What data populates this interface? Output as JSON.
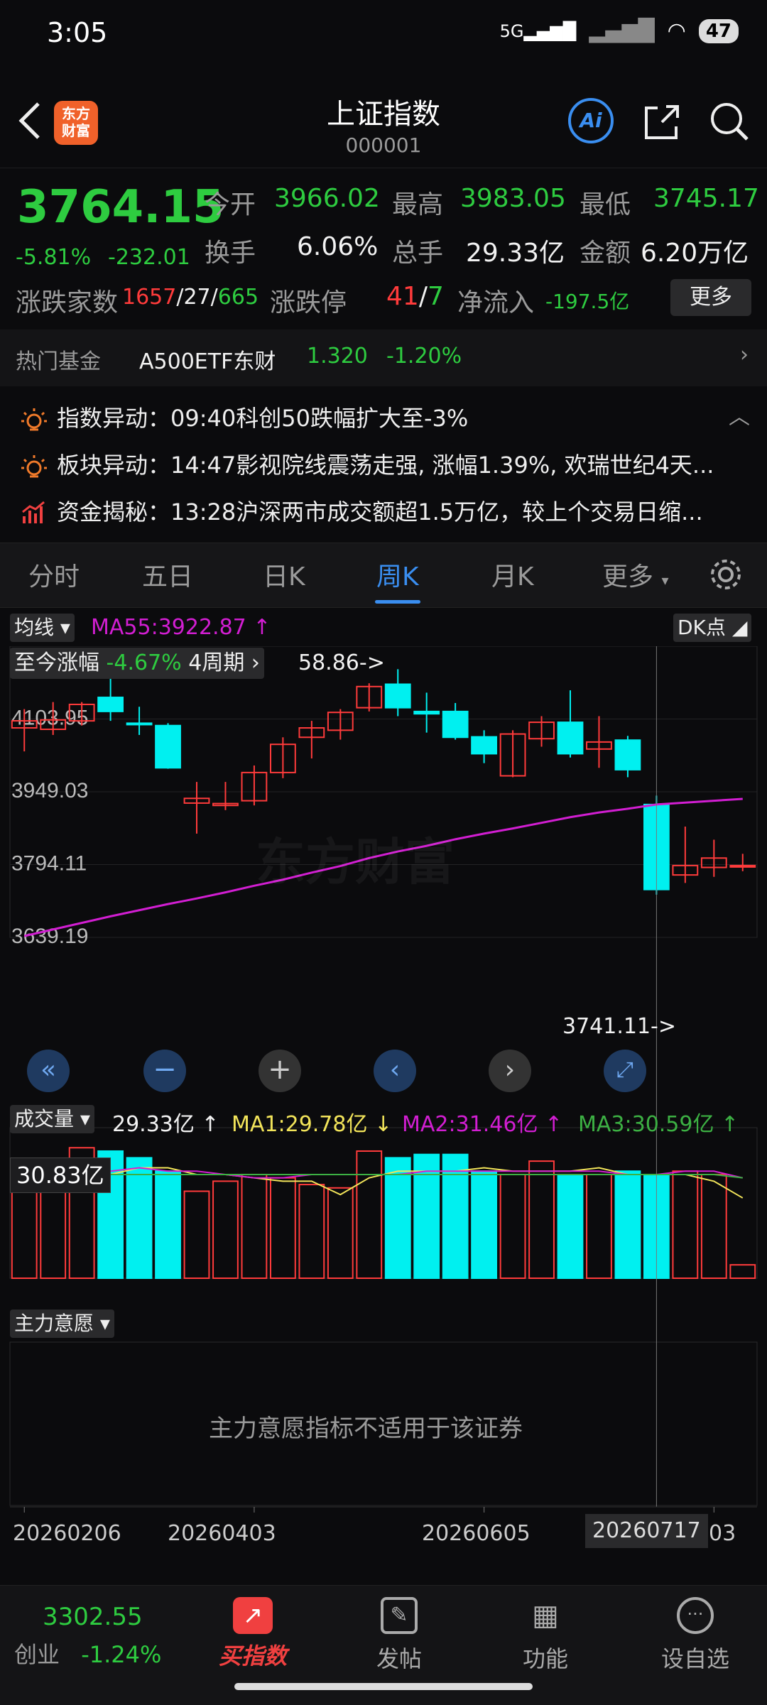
{
  "status": {
    "time": "3:05",
    "network": "5G",
    "battery": "47"
  },
  "header": {
    "title": "上证指数",
    "code": "000001",
    "logo_text": "东方财富",
    "ai_label": "Ai"
  },
  "quote": {
    "price": "3764.15",
    "change_pct": "-5.81%",
    "change_abs": "-232.01",
    "open_label": "今开",
    "open": "3966.02",
    "high_label": "最高",
    "high": "3983.05",
    "low_label": "最低",
    "low": "3745.17",
    "turnover_label": "换手",
    "turnover": "6.06%",
    "volume_label": "总手",
    "volume": "29.33亿",
    "amount_label": "金额",
    "amount": "6.20万亿",
    "breadth_label": "涨跌家数",
    "up": "1657",
    "flat": "27",
    "down": "665",
    "limit_label": "涨跌停",
    "limit_up": "41",
    "limit_down": "7",
    "netflow_label": "净流入",
    "netflow": "-197.5亿",
    "more_label": "更多"
  },
  "hot_fund": {
    "label": "热门基金",
    "name": "A500ETF东财",
    "price": "1.320",
    "change": "-1.20%"
  },
  "news": [
    {
      "text": "指数异动：09:40科创50跌幅扩大至-3%",
      "icon": "bulb-icon"
    },
    {
      "text": "板块异动：14:47影视院线震荡走强, 涨幅1.39%, 欢瑞世纪4天...",
      "icon": "bulb-icon"
    },
    {
      "text": "资金揭秘：13:28沪深两市成交额超1.5万亿，较上个交易日缩...",
      "icon": "money-chart-icon"
    }
  ],
  "tabs": [
    "分时",
    "五日",
    "日K",
    "周K",
    "月K",
    "更多"
  ],
  "chart": {
    "ma_selector": "均线",
    "ma55_label": "MA55:3922.87 ↑",
    "dk_label": "DK点",
    "since_label": "至今涨幅",
    "since_value": "-4.67%",
    "since_period": "4周期",
    "high_marker": "58.86->",
    "low_marker": "3741.11->",
    "watermark": "东方财富",
    "volume_selector": "成交量",
    "volume_value": "29.33亿 ↑",
    "ma1": "MA1:29.78亿 ↓",
    "ma2": "MA2:31.46亿 ↑",
    "ma3": "MA3:30.59亿 ↑",
    "cursor_volume": "30.83亿",
    "main_will_selector": "主力意愿",
    "main_will_text": "主力意愿指标不适用于该证券",
    "date_labels": [
      "20260206",
      "20260403",
      "20260605"
    ],
    "cursor_date": "20260717",
    "last_date_fragment": "03"
  },
  "chart_data": {
    "type": "candlestick",
    "y_ticks": [
      "4103.95",
      "3949.03",
      "3794.11",
      "3639.19"
    ],
    "ylim": [
      3639.19,
      4258.87
    ],
    "candles": [
      {
        "o": 4085,
        "c": 4100,
        "h": 4125,
        "l": 4035
      },
      {
        "o": 4082,
        "c": 4102,
        "h": 4140,
        "l": 4070
      },
      {
        "o": 4100,
        "c": 4135,
        "h": 4140,
        "l": 4090
      },
      {
        "o": 4150,
        "c": 4120,
        "h": 4195,
        "l": 4100
      },
      {
        "o": 4095,
        "c": 4093,
        "h": 4130,
        "l": 4070
      },
      {
        "o": 4090,
        "c": 4000,
        "h": 4095,
        "l": 3998
      },
      {
        "o": 3925,
        "c": 3935,
        "h": 3970,
        "l": 3860
      },
      {
        "o": 3920,
        "c": 3924,
        "h": 3970,
        "l": 3910
      },
      {
        "o": 3930,
        "c": 3990,
        "h": 4005,
        "l": 3920
      },
      {
        "o": 3990,
        "c": 4050,
        "h": 4065,
        "l": 3978
      },
      {
        "o": 4065,
        "c": 4085,
        "h": 4100,
        "l": 4020
      },
      {
        "o": 4080,
        "c": 4118,
        "h": 4125,
        "l": 4060
      },
      {
        "o": 4128,
        "c": 4173,
        "h": 4180,
        "l": 4120
      },
      {
        "o": 4178,
        "c": 4128,
        "h": 4210,
        "l": 4110
      },
      {
        "o": 4120,
        "c": 4115,
        "h": 4160,
        "l": 4075
      },
      {
        "o": 4120,
        "c": 4065,
        "h": 4138,
        "l": 4060
      },
      {
        "o": 4066,
        "c": 4030,
        "h": 4080,
        "l": 4010
      },
      {
        "o": 3983,
        "c": 4072,
        "h": 4080,
        "l": 3980
      },
      {
        "o": 4062,
        "c": 4097,
        "h": 4110,
        "l": 4045
      },
      {
        "o": 4097,
        "c": 4030,
        "h": 4165,
        "l": 4022
      },
      {
        "o": 4040,
        "c": 4055,
        "h": 4110,
        "l": 4000
      },
      {
        "o": 4059,
        "c": 3996,
        "h": 4068,
        "l": 3980
      },
      {
        "o": 3922,
        "c": 3741,
        "h": 3941,
        "l": 3730
      },
      {
        "o": 3772,
        "c": 3792,
        "h": 3875,
        "l": 3755
      },
      {
        "o": 3788,
        "c": 3808,
        "h": 3847,
        "l": 3768
      },
      {
        "o": 3790,
        "c": 3792,
        "h": 3817,
        "l": 3780
      }
    ],
    "ma55": [
      3642,
      3656,
      3670,
      3684,
      3697,
      3710,
      3722,
      3735,
      3749,
      3762,
      3777,
      3791,
      3808,
      3822,
      3834,
      3848,
      3860,
      3871,
      3883,
      3895,
      3905,
      3913,
      3922,
      3926,
      3930,
      3934
    ],
    "volume_ylim": [
      0,
      45
    ],
    "volume": [
      30,
      31,
      39,
      38,
      36,
      32,
      26,
      29,
      31,
      30,
      28,
      27,
      38,
      36,
      37,
      37,
      32,
      31,
      35,
      31,
      31,
      32,
      31,
      32,
      31,
      4
    ],
    "vol_ma1": [
      35,
      33,
      32,
      31,
      33,
      33,
      31,
      31,
      30,
      29,
      29,
      25,
      30,
      32,
      32,
      32,
      33,
      32,
      32,
      32,
      33,
      31,
      31,
      31,
      29,
      24
    ],
    "vol_ma2": [
      33,
      32,
      32,
      32,
      33,
      32,
      32,
      31,
      30,
      30,
      31,
      31,
      31,
      31,
      32,
      32,
      32,
      32,
      32,
      32,
      32,
      31,
      31,
      32,
      32,
      30
    ],
    "vol_ma3": [
      31,
      31,
      31,
      31,
      31,
      31,
      31,
      31,
      31,
      31,
      31,
      31,
      31,
      31,
      31,
      31,
      31,
      31,
      31,
      31,
      31,
      31,
      31,
      31,
      31,
      30
    ],
    "colors": {
      "up": "#ff3b3b",
      "down": "#00f0f0",
      "ma55": "#d21ed2",
      "ma1": "#f2e45a",
      "ma2": "#d21ed2",
      "ma3": "#3cb043"
    }
  },
  "bottom_nav": {
    "ticker_price": "3302.55",
    "ticker_name": "创业",
    "ticker_change": "-1.24%",
    "items": [
      "买指数",
      "发帖",
      "功能",
      "设自选"
    ]
  }
}
